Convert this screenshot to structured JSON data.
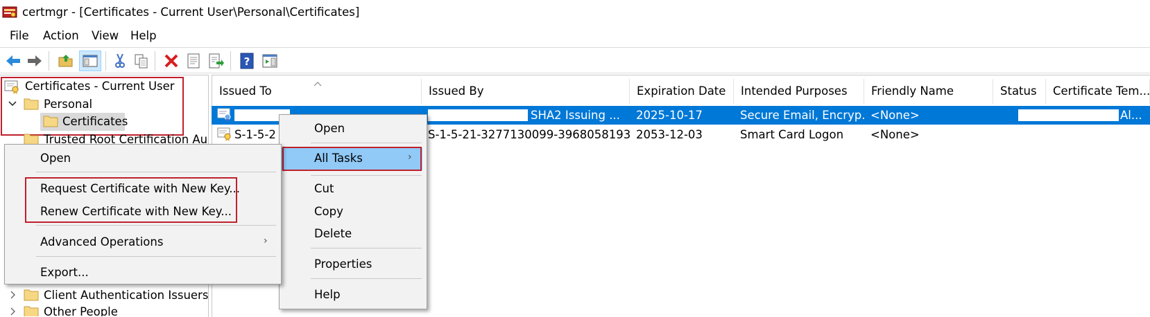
{
  "window": {
    "title": "certmgr - [Certificates - Current User\\Personal\\Certificates]",
    "app_icon": "certmgr-icon"
  },
  "menubar": {
    "items": [
      "File",
      "Action",
      "View",
      "Help"
    ]
  },
  "toolbar": {
    "buttons": [
      "back-icon",
      "forward-icon",
      "up-folder-icon",
      "show-hide-tree-icon",
      "cut-icon",
      "copy-icon",
      "delete-icon",
      "properties-icon",
      "export-list-icon",
      "help-icon",
      "action-pane-icon"
    ]
  },
  "tree": {
    "root": "Certificates - Current User",
    "personal": "Personal",
    "certificates": "Certificates",
    "trusted_root_partial": "Trusted Root Certification Aut",
    "client_auth": "Client Authentication Issuers",
    "other_people": "Other People"
  },
  "list": {
    "columns": [
      "Issued To",
      "Issued By",
      "Expiration Date",
      "Intended Purposes",
      "Friendly Name",
      "Status",
      "Certificate Tem..."
    ],
    "rows": [
      {
        "issued_to": "",
        "issued_by": "SHA2 Issuing ...",
        "expiration": "2025-10-17",
        "purposes": "Secure Email, Encryp...",
        "friendly": "<None>",
        "status": "",
        "template": "Al..."
      },
      {
        "issued_to": "S-1-5-2",
        "issued_by": "S-1-5-21-3277130099-3968058193-...",
        "expiration": "2053-12-03",
        "purposes": "Smart Card Logon",
        "friendly": "<None>",
        "status": "",
        "template": ""
      }
    ]
  },
  "context_menu_main": {
    "open": "Open",
    "all_tasks": "All Tasks",
    "cut": "Cut",
    "copy": "Copy",
    "delete": "Delete",
    "properties": "Properties",
    "help": "Help"
  },
  "context_menu_tasks": {
    "open": "Open",
    "request_new_key": "Request Certificate with New Key...",
    "renew_new_key": "Renew Certificate with New Key...",
    "advanced": "Advanced Operations",
    "export": "Export..."
  },
  "colors": {
    "selection": "#0078d7",
    "highlight": "#91c9f7",
    "annotation_box": "#c0202c",
    "menu_bg": "#f2f2f2"
  }
}
